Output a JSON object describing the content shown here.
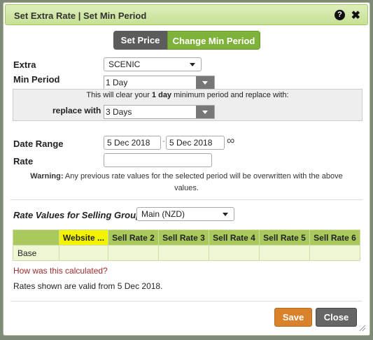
{
  "dialog": {
    "title": "Set Extra Rate | Set Min Period"
  },
  "mode_tabs": {
    "set_price": "Set Price",
    "change_min_period": "Change Min Period"
  },
  "form": {
    "extra_label": "Extra",
    "extra_value": "SCENIC",
    "min_period_label": "Min Period",
    "min_period_value": "1 Day",
    "clear_msg_pre": "This will clear your ",
    "clear_msg_bold": "1 day",
    "clear_msg_post": " minimum period and replace with:",
    "replace_with_label": "replace with",
    "replace_with_value": "3 Days",
    "date_range_label": "Date Range",
    "date_from": "5 Dec 2018",
    "date_sep": "-",
    "date_to": "5 Dec 2018",
    "infinity": "∞",
    "rate_label": "Rate",
    "rate_value": "",
    "warning_bold": "Warning:",
    "warning_text": " Any previous rate values for the selected period will be overwritten with the above values."
  },
  "rates": {
    "group_label": "Rate Values for Selling Group:",
    "group_value": "Main (NZD)",
    "headers": [
      "",
      "Website ...",
      "Sell Rate 2",
      "Sell Rate 3",
      "Sell Rate 4",
      "Sell Rate 5",
      "Sell Rate 6"
    ],
    "row_label": "Base",
    "row_values": [
      "",
      "",
      "",
      "",
      "",
      ""
    ]
  },
  "footer": {
    "how_link": "How was this calculated?",
    "valid_note": "Rates shown are valid from 5 Dec 2018.",
    "save": "Save",
    "close": "Close"
  },
  "colors": {
    "accent": "#7fb23a",
    "save": "#d9822b",
    "highlight": "#f3f300"
  }
}
